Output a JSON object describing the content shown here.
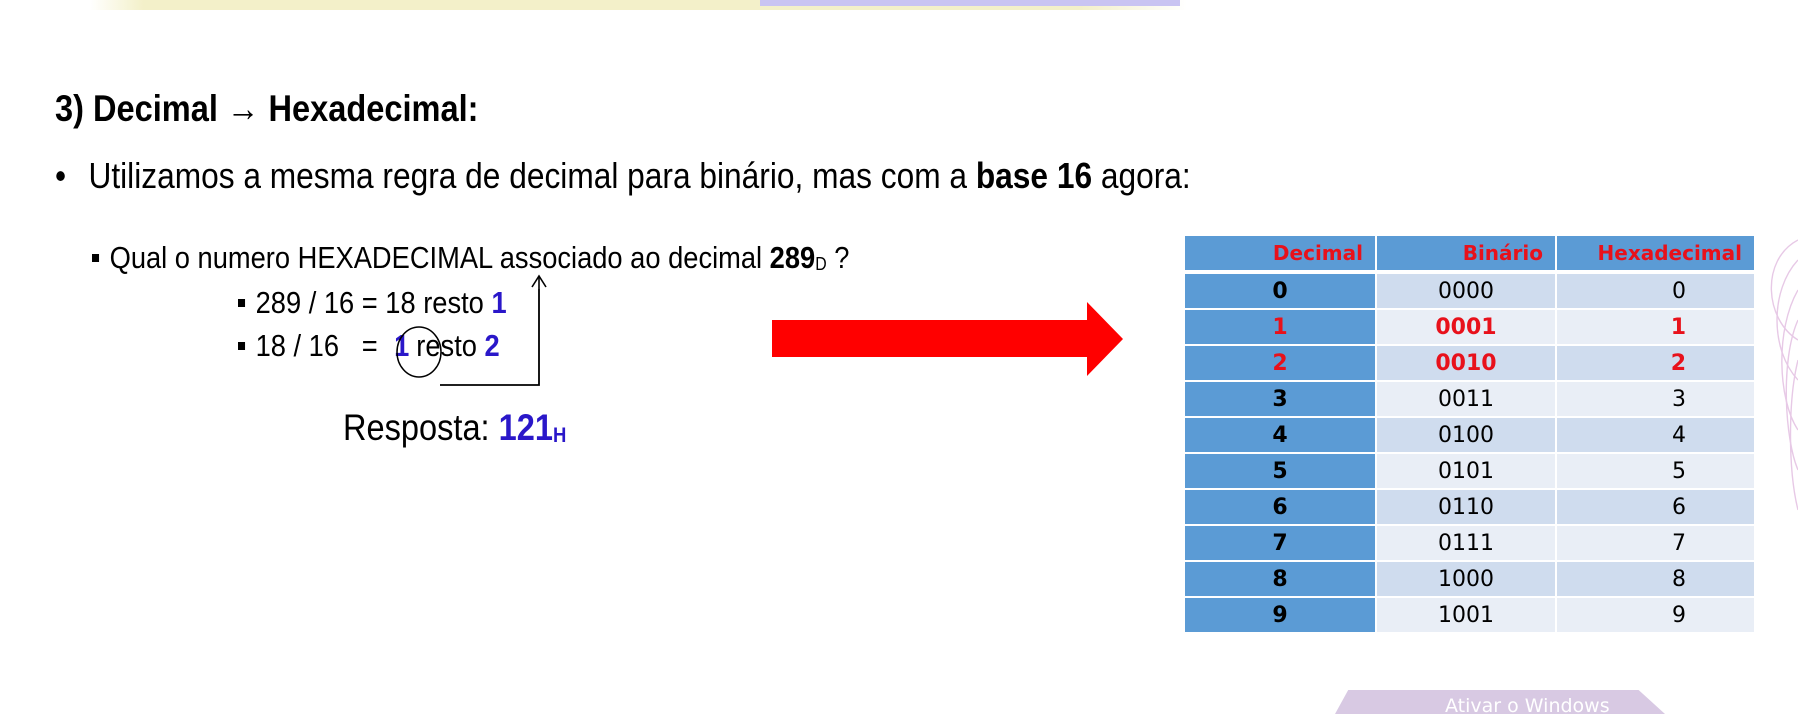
{
  "slide": {
    "heading": "3) Decimal → Hexadecimal:",
    "bullet": {
      "prefix": "Utilizamos a mesma regra de decimal para binário, mas com a ",
      "bold": "base 16",
      "suffix": " agora:"
    },
    "question": {
      "prefix": "Qual o numero HEXADECIMAL associado ao decimal ",
      "number": "289",
      "subscript": "D",
      "suffix": " ?"
    },
    "steps": [
      {
        "expr": "289 / 16 = 18 resto ",
        "remainder": "1"
      },
      {
        "expr_a": "18 / 16   = ",
        "quotient": "1",
        "expr_b": "resto ",
        "remainder": "2"
      }
    ],
    "answer": {
      "label": "Resposta: ",
      "value": "121",
      "subscript": "H"
    }
  },
  "table": {
    "headers": [
      "Decimal",
      "Binário",
      "Hexadecimal"
    ],
    "rows": [
      {
        "dec": "0",
        "bin": "0000",
        "hex": "0",
        "highlight": false
      },
      {
        "dec": "1",
        "bin": "0001",
        "hex": "1",
        "highlight": true
      },
      {
        "dec": "2",
        "bin": "0010",
        "hex": "2",
        "highlight": true
      },
      {
        "dec": "3",
        "bin": "0011",
        "hex": "3",
        "highlight": false
      },
      {
        "dec": "4",
        "bin": "0100",
        "hex": "4",
        "highlight": false
      },
      {
        "dec": "5",
        "bin": "0101",
        "hex": "5",
        "highlight": false
      },
      {
        "dec": "6",
        "bin": "0110",
        "hex": "6",
        "highlight": false
      },
      {
        "dec": "7",
        "bin": "0111",
        "hex": "7",
        "highlight": false
      },
      {
        "dec": "8",
        "bin": "1000",
        "hex": "8",
        "highlight": false
      },
      {
        "dec": "9",
        "bin": "1001",
        "hex": "9",
        "highlight": false
      }
    ]
  },
  "watermark": "Ativar o Windows",
  "colors": {
    "accent_blue": "#2a17c9",
    "highlight_red": "#e8111b",
    "arrow_red": "#ff0000",
    "table_header": "#5b9bd5"
  }
}
